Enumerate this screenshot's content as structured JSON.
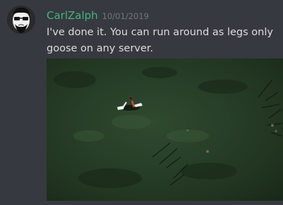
{
  "message": {
    "author": "CarlZalph",
    "timestamp": "10/01/2019",
    "lines": [
      "I've done it.  You can run around as legs only",
      "goose on any server."
    ]
  },
  "avatar": {
    "icon": "bearded-face-avatar"
  },
  "attachment": {
    "icon": "game-screenshot-goose-legs"
  },
  "colors": {
    "background": "#36393f",
    "username": "#43b581",
    "text": "#dcddde",
    "timestamp": "#72767d",
    "grass_dark": "#1a2a1a",
    "grass_mid": "#2f4a2f"
  }
}
